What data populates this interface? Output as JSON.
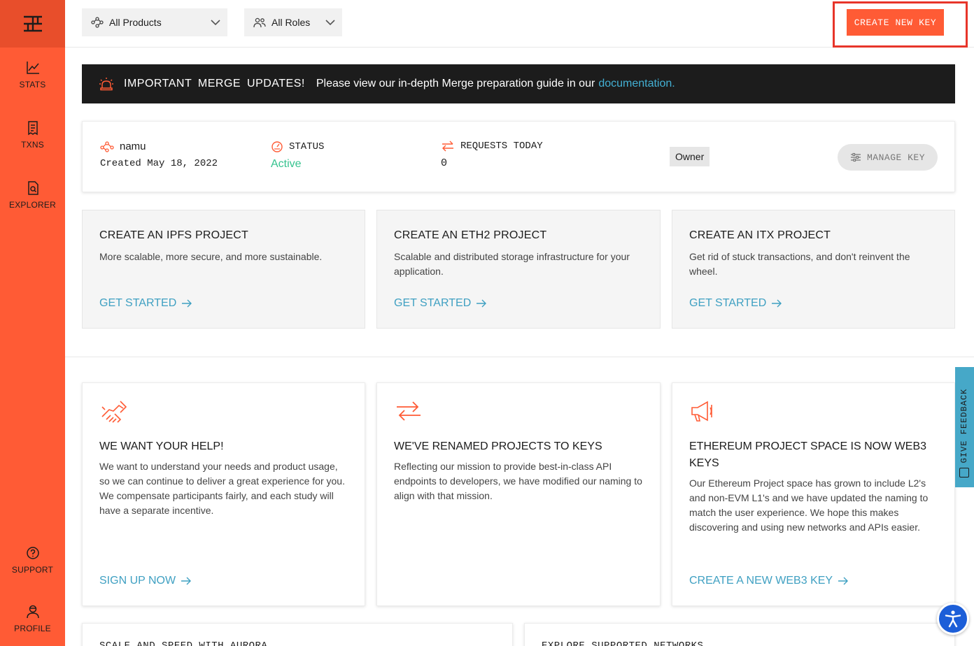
{
  "sidebar": {
    "items": [
      {
        "label": "STATS",
        "icon": "chart-line-icon"
      },
      {
        "label": "TXNS",
        "icon": "receipt-icon"
      },
      {
        "label": "EXPLORER",
        "icon": "file-search-icon"
      },
      {
        "label": "SUPPORT",
        "icon": "question-circle-icon"
      },
      {
        "label": "PROFILE",
        "icon": "user-icon"
      }
    ]
  },
  "topbar": {
    "products_select": "All Products",
    "roles_select": "All Roles",
    "create_key_label": "CREATE NEW KEY"
  },
  "banner": {
    "important": "IMPORTANT MERGE UPDATES!",
    "message": "Please view our in-depth Merge preparation guide in our",
    "link": "documentation."
  },
  "key_card": {
    "name": "namu",
    "created": "Created May 18, 2022",
    "status_label": "STATUS",
    "status_value": "Active",
    "requests_label": "REQUESTS TODAY",
    "requests_value": "0",
    "role_badge": "Owner",
    "manage_label": "MANAGE KEY"
  },
  "projects": [
    {
      "title": "CREATE AN IPFS PROJECT",
      "desc": "More scalable, more secure, and more sustainable.",
      "cta": "GET STARTED"
    },
    {
      "title": "CREATE AN ETH2 PROJECT",
      "desc": "Scalable and distributed storage infrastructure for your application.",
      "cta": "GET STARTED"
    },
    {
      "title": "CREATE AN ITX PROJECT",
      "desc": "Get rid of stuck transactions, and don't reinvent the wheel.",
      "cta": "GET STARTED"
    }
  ],
  "info": [
    {
      "title": "WE WANT YOUR HELP!",
      "desc": "We want to understand your needs and product usage, so we can continue to deliver a great experience for you. We compensate participants fairly, and each study will have a separate incentive.",
      "cta": "SIGN UP NOW"
    },
    {
      "title": "WE'VE RENAMED PROJECTS TO KEYS",
      "desc": "Reflecting our mission to provide best-in-class API endpoints to developers, we have modified our naming to align with that mission.",
      "cta": ""
    },
    {
      "title": "ETHEREUM PROJECT SPACE IS NOW WEB3 KEYS",
      "desc": "Our Ethereum Project space has grown to include L2's and non-EVM L1's and we have updated the naming to match the user experience. We hope this makes discovering and using new networks and APIs easier.",
      "cta": "CREATE A NEW WEB3 KEY"
    }
  ],
  "bottom_cards": [
    "SCALE AND SPEED WITH AURORA",
    "EXPLORE SUPPORTED NETWORKS"
  ],
  "feedback_label": "GIVE FEEDBACK",
  "colors": {
    "accent": "#ff5b35",
    "link": "#3fa0c2",
    "active": "#36c38f",
    "banner": "#1c1c1c"
  }
}
